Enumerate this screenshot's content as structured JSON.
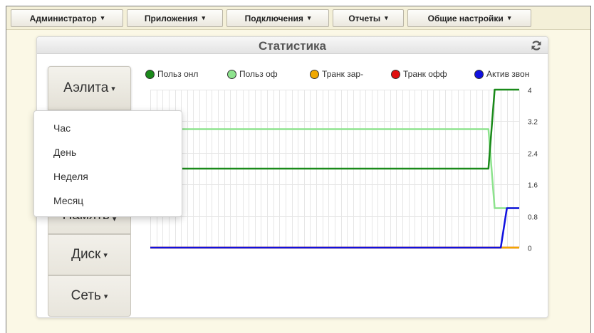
{
  "topbar": {
    "menus": [
      {
        "label": "Администратор"
      },
      {
        "label": "Приложения"
      },
      {
        "label": "Подключения"
      },
      {
        "label": "Отчеты"
      },
      {
        "label": "Общие настройки"
      }
    ],
    "caret": "▾"
  },
  "panel": {
    "title": "Статистика",
    "refresh_icon": "refresh-icon"
  },
  "sidebar": {
    "items": [
      {
        "label": "Аэлита"
      },
      {
        "label": "Память"
      },
      {
        "label": "Диск"
      },
      {
        "label": "Сеть"
      }
    ],
    "caret": "▾"
  },
  "dropdown": {
    "items": [
      {
        "label": "Час"
      },
      {
        "label": "День"
      },
      {
        "label": "Неделя"
      },
      {
        "label": "Месяц"
      }
    ]
  },
  "chart_data": {
    "type": "line",
    "x": [
      0,
      1,
      2,
      3,
      4,
      5,
      6,
      7,
      8,
      9,
      10,
      11,
      12,
      13,
      14,
      15,
      16,
      17,
      18,
      19,
      20,
      21,
      22,
      23,
      24,
      25,
      26,
      27,
      28,
      29,
      30,
      31,
      32,
      33,
      34,
      35,
      36,
      37,
      38,
      39,
      40,
      41,
      42,
      43,
      44,
      45,
      46,
      47,
      48,
      49,
      50,
      51,
      52,
      53,
      54,
      55,
      56,
      57,
      58,
      59,
      60
    ],
    "series": [
      {
        "name": "Польз онл",
        "color": "#1a8a1a",
        "values": [
          2,
          2,
          2,
          2,
          2,
          2,
          2,
          2,
          2,
          2,
          2,
          2,
          2,
          2,
          2,
          2,
          2,
          2,
          2,
          2,
          2,
          2,
          2,
          2,
          2,
          2,
          2,
          2,
          2,
          2,
          2,
          2,
          2,
          2,
          2,
          2,
          2,
          2,
          2,
          2,
          2,
          2,
          2,
          2,
          2,
          2,
          2,
          2,
          2,
          2,
          2,
          2,
          2,
          2,
          2,
          2,
          4,
          4,
          4,
          4,
          4
        ]
      },
      {
        "name": "Польз оф",
        "color": "#8de38d",
        "values": [
          3,
          3,
          3,
          3,
          3,
          3,
          3,
          3,
          3,
          3,
          3,
          3,
          3,
          3,
          3,
          3,
          3,
          3,
          3,
          3,
          3,
          3,
          3,
          3,
          3,
          3,
          3,
          3,
          3,
          3,
          3,
          3,
          3,
          3,
          3,
          3,
          3,
          3,
          3,
          3,
          3,
          3,
          3,
          3,
          3,
          3,
          3,
          3,
          3,
          3,
          3,
          3,
          3,
          3,
          3,
          3,
          1,
          1,
          1,
          1,
          1
        ]
      },
      {
        "name": "Транк зар-",
        "color": "#f0a800",
        "values": [
          0,
          0,
          0,
          0,
          0,
          0,
          0,
          0,
          0,
          0,
          0,
          0,
          0,
          0,
          0,
          0,
          0,
          0,
          0,
          0,
          0,
          0,
          0,
          0,
          0,
          0,
          0,
          0,
          0,
          0,
          0,
          0,
          0,
          0,
          0,
          0,
          0,
          0,
          0,
          0,
          0,
          0,
          0,
          0,
          0,
          0,
          0,
          0,
          0,
          0,
          0,
          0,
          0,
          0,
          0,
          0,
          0,
          0,
          0,
          0,
          0
        ]
      },
      {
        "name": "Транк офф",
        "color": "#e01010",
        "values": [
          0,
          0,
          0,
          0,
          0,
          0,
          0,
          0,
          0,
          0,
          0,
          0,
          0,
          0,
          0,
          0,
          0,
          0,
          0,
          0,
          0,
          0,
          0,
          0,
          0,
          0,
          0,
          0,
          0,
          0,
          0,
          0,
          0,
          0,
          0,
          0,
          0,
          0,
          0,
          0,
          0,
          0,
          0,
          0,
          0,
          0,
          0,
          0,
          0,
          0,
          0,
          0,
          0,
          0,
          0,
          0,
          0,
          0,
          0,
          0,
          0
        ]
      },
      {
        "name": "Актив звон",
        "color": "#1010e0",
        "values": [
          0,
          0,
          0,
          0,
          0,
          0,
          0,
          0,
          0,
          0,
          0,
          0,
          0,
          0,
          0,
          0,
          0,
          0,
          0,
          0,
          0,
          0,
          0,
          0,
          0,
          0,
          0,
          0,
          0,
          0,
          0,
          0,
          0,
          0,
          0,
          0,
          0,
          0,
          0,
          0,
          0,
          0,
          0,
          0,
          0,
          0,
          0,
          0,
          0,
          0,
          0,
          0,
          0,
          0,
          0,
          0,
          0,
          0,
          1,
          1,
          1
        ]
      }
    ],
    "yticks": [
      "0",
      "0.8",
      "1.6",
      "2.4",
      "3.2",
      "4"
    ],
    "ylim": [
      0,
      4
    ],
    "grid": true,
    "legend_position": "top"
  }
}
